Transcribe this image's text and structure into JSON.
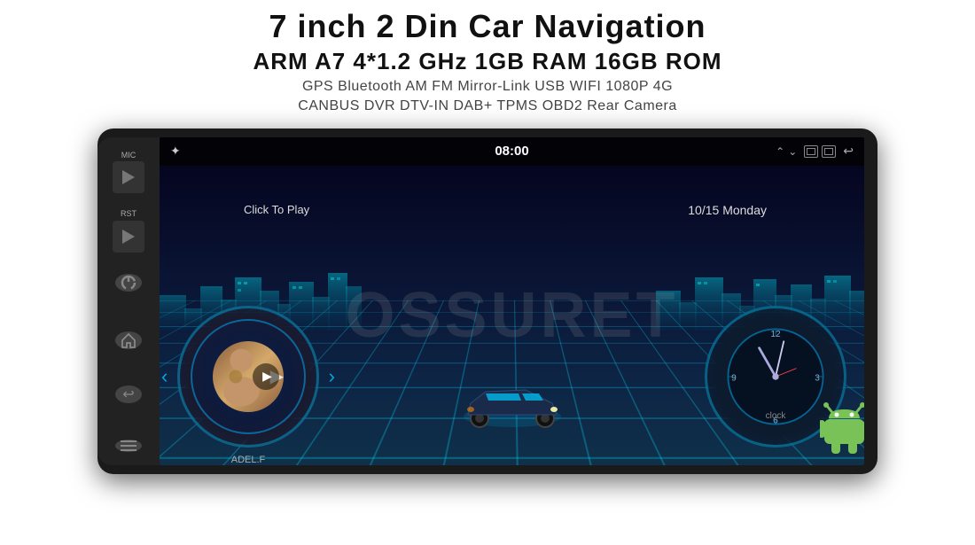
{
  "header": {
    "title": "7 inch 2 Din Car Navigation",
    "specs": "ARM A7 4*1.2 GHz    1GB RAM    16GB ROM",
    "features_line1": "GPS  Bluetooth  AM  FM  Mirror-Link  USB  WIFI  1080P  4G",
    "features_line2": "CANBUS   DVR   DTV-IN   DAB+   TPMS   OBD2   Rear Camera"
  },
  "screen": {
    "time": "08:00",
    "date": "10/15 Monday",
    "click_to_play": "Click To Play",
    "artist": "ADEL.F",
    "clock_label": "clock",
    "prev_btn": "‹",
    "next_btn": "›"
  },
  "side_panel": {
    "mic_label": "MIC",
    "rst_label": "RST"
  },
  "watermark": "OSSURET",
  "status_bar": {
    "bluetooth_icon": "⚡",
    "back_icon": "↩",
    "home_icon": "⌂",
    "power_icon": "⏻"
  }
}
